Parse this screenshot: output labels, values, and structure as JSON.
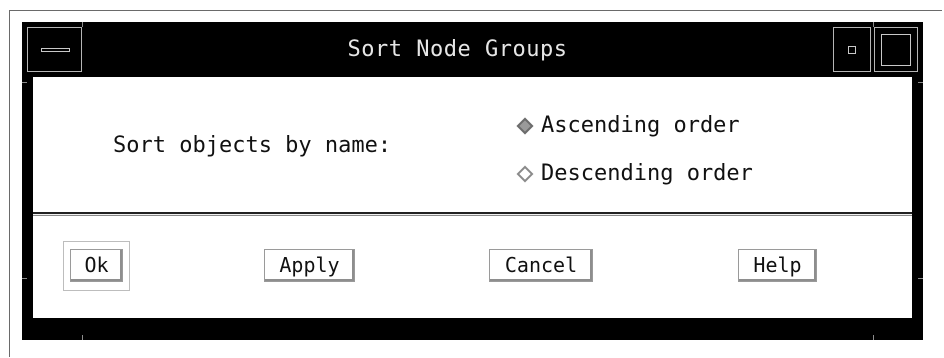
{
  "dialog": {
    "title": "Sort Node Groups",
    "prompt_label": "Sort objects by name:",
    "sort_options": [
      {
        "label": "Ascending order",
        "selected": true
      },
      {
        "label": "Descending order",
        "selected": false
      }
    ],
    "buttons": {
      "ok": "Ok",
      "apply": "Apply",
      "cancel": "Cancel",
      "help": "Help"
    }
  },
  "icons": {
    "window_menu": "window-menu-icon",
    "minimize": "minimize-icon",
    "maximize": "maximize-icon",
    "radio_selected": "radio-diamond-selected-icon",
    "radio_unselected": "radio-diamond-unselected-icon"
  },
  "colors": {
    "frame": "#000000",
    "panel": "#ffffff",
    "title_text": "#e6e6e6",
    "selected_radio": "#9a9a9a"
  }
}
